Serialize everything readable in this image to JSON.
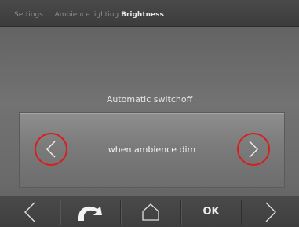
{
  "breadcrumb": {
    "path": "Settings … Ambience lighting",
    "current": "Brightness"
  },
  "setting": {
    "label": "Automatic switchoff",
    "value": "when ambience dim",
    "prev_icon": "chevron-left-icon",
    "next_icon": "chevron-right-icon"
  },
  "toolbar": {
    "back_icon": "triangle-left-icon",
    "return_icon": "return-arrow-icon",
    "home_icon": "home-icon",
    "ok_label": "OK",
    "forward_icon": "triangle-right-icon"
  },
  "colors": {
    "highlight_ring": "#d91e1e",
    "text": "#e6e6e6",
    "panel": "#7b7b7b",
    "toolbar": "#3e3e3e"
  }
}
